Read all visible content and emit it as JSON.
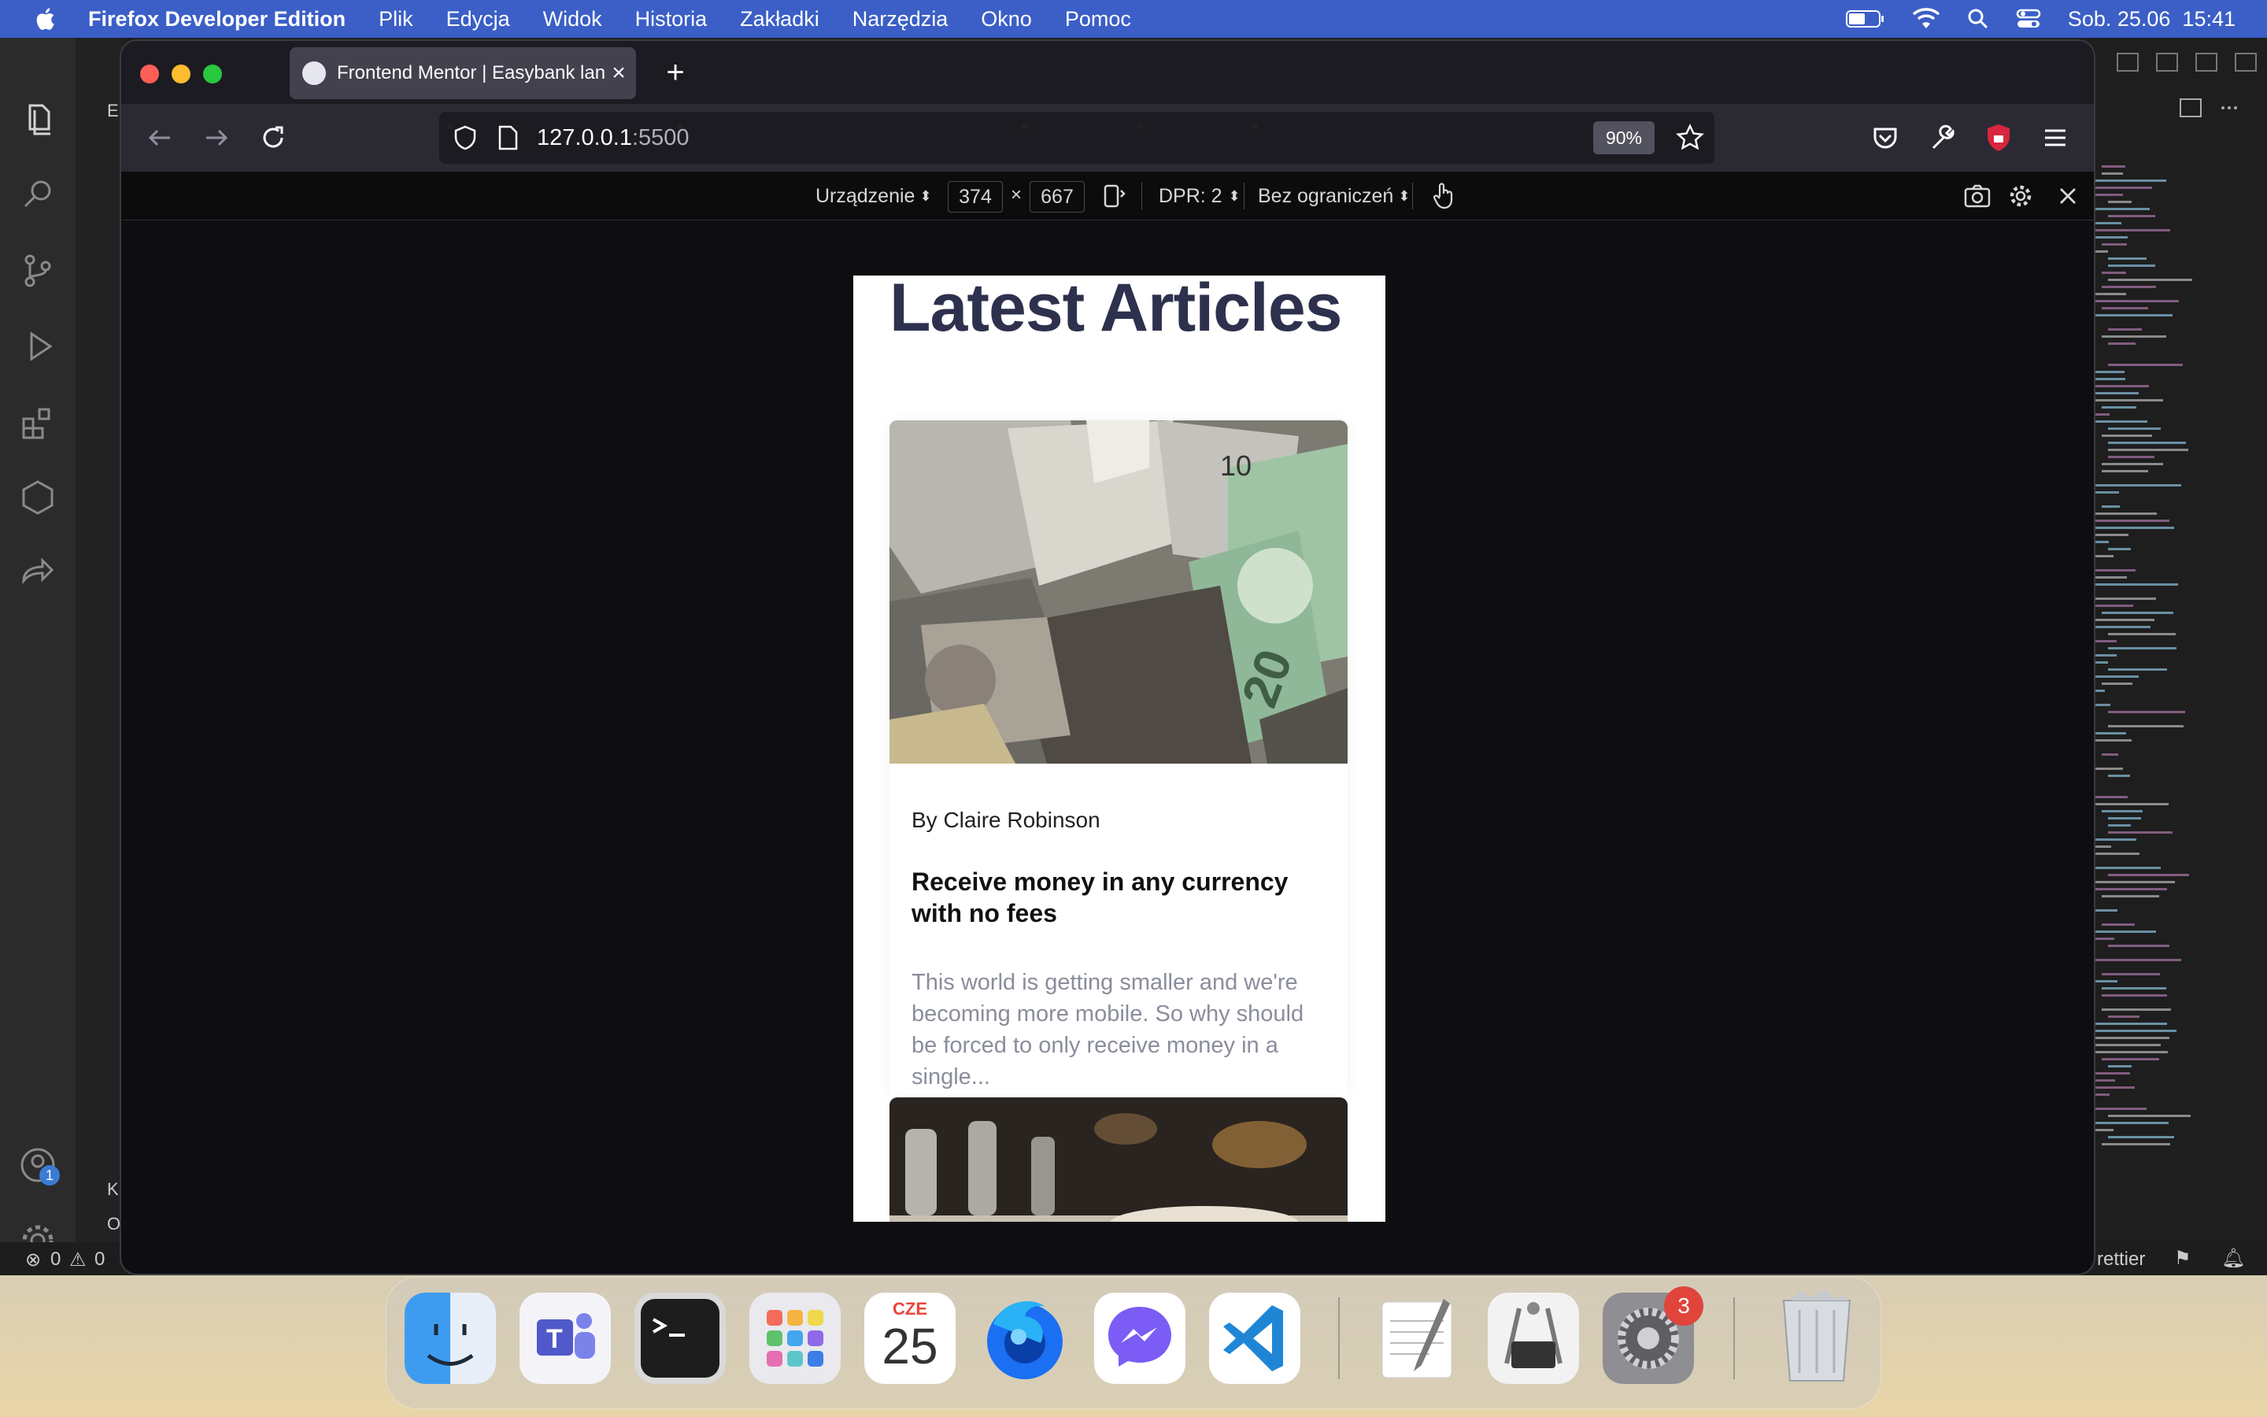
{
  "menubar": {
    "app": "Firefox Developer Edition",
    "items": [
      "Plik",
      "Edycja",
      "Widok",
      "Historia",
      "Zakładki",
      "Narzędzia",
      "Okno",
      "Pomoc"
    ],
    "clock": "Sob. 25.06  15:41"
  },
  "browser": {
    "tab_title": "Frontend Mentor | Easybank landing page",
    "tab_close": "×",
    "new_tab": "+",
    "url_host": "127.0.0.1",
    "url_port": ":5500",
    "zoom": "90%"
  },
  "rdm": {
    "device": "Urządzenie",
    "width": "374",
    "times": "×",
    "height": "667",
    "dpr": "DPR: 2",
    "throttle": "Bez ograniczeń"
  },
  "page": {
    "title": "Latest Articles",
    "article": {
      "author": "By Claire Robinson",
      "headline": "Receive money in any currency with no fees",
      "excerpt": "This world is getting smaller and we're becoming more mobile. So why should be forced to only receive money in a single..."
    }
  },
  "vscode": {
    "status_errors": "0",
    "status_warnings": "0",
    "status_prettier": "rettier",
    "sidebar_letters": [
      "E",
      "K",
      "O"
    ],
    "accounts_badge": "1"
  },
  "dock": {
    "calendar_month": "CZE",
    "calendar_day": "25",
    "settings_badge": "3"
  },
  "colors": {
    "menubar": "#3b5fc6",
    "browser_chrome": "#2b2a33",
    "page_title": "#2d314d",
    "excerpt": "#8a8d9b"
  }
}
